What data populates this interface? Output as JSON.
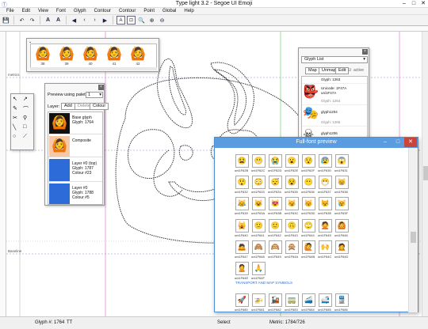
{
  "window": {
    "title": "Type light 3.2  -  Segoe UI Emoji"
  },
  "menu": [
    "File",
    "Edit",
    "View",
    "Font",
    "Glyph",
    "Contour",
    "Contour",
    "Point",
    "Global",
    "Help"
  ],
  "guides": {
    "metrics_label": "metrics",
    "baseline_label": "Baseline"
  },
  "palette_strip": {
    "labels": [
      "38",
      "39",
      "40",
      "41",
      "42"
    ]
  },
  "preview_panel": {
    "title": "Preview using palette:",
    "palette_value": "1",
    "layer_label": "Layer:",
    "add_label": "Add",
    "delete_label": "Delete",
    "colour_label": "Colour",
    "layers": [
      {
        "name": "Base glyph",
        "sub": "Glyph: 1764"
      },
      {
        "name": "Composite",
        "sub": ""
      },
      {
        "name": "Layer #0 (top)",
        "sub": "Glyph: 1787",
        "extra": "Colour #23"
      },
      {
        "name": "Layer #0",
        "sub": "Glyph: 1788",
        "extra": "Colour #5"
      }
    ]
  },
  "glyph_list": {
    "title": "Glyph List",
    "tabs": [
      "Map",
      "Unmap",
      "Edit"
    ],
    "active_label": "active",
    "items": [
      {
        "label": "Glyph: 1263"
      },
      {
        "label": "Unicode: 1F47A",
        "sub": "uni1F47A"
      },
      {
        "label": "Glyph: 1264"
      },
      {
        "label": "glyph1204"
      },
      {
        "label": "Glyph: 1265"
      },
      {
        "label": "glyph1206"
      },
      {
        "label": "Glyph: 1266"
      }
    ]
  },
  "full_font": {
    "title": "Full-font preview",
    "row_labels": [
      [
        "uni1F62B",
        "uni1F62C",
        "uni1F62D",
        "uni1F62E",
        "uni1F62F",
        "uni1F630",
        "uni1F631"
      ],
      [
        "uni1F632",
        "uni1F633",
        "uni1F634",
        "uni1F635",
        "uni1F636",
        "uni1F637",
        "uni1F638"
      ],
      [
        "uni1F639",
        "uni1F63A",
        "uni1F63B",
        "uni1F63C",
        "uni1F63D",
        "uni1F63E",
        "uni1F63F"
      ],
      [
        "uni1F640",
        "uni1F641",
        "uni1F642",
        "uni1F643",
        "uni1F644",
        "uni1F645",
        "uni1F646"
      ],
      [
        "uni1F647",
        "uni1F648",
        "uni1F649",
        "uni1F64A",
        "uni1F64B",
        "uni1F64C",
        "uni1F64D"
      ],
      [
        "uni1F64E",
        "uni1F64F"
      ],
      [
        "uni1F680",
        "uni1F681",
        "uni1F682",
        "uni1F683",
        "uni1F684",
        "uni1F685",
        "uni1F686"
      ]
    ],
    "rows_glyphs": [
      [
        "😫",
        "😬",
        "😭",
        "😮",
        "😯",
        "😰",
        "😱"
      ],
      [
        "😲",
        "😳",
        "😴",
        "😵",
        "😶",
        "😷",
        "😸"
      ],
      [
        "😹",
        "😺",
        "😻",
        "😼",
        "😽",
        "😾",
        "😿"
      ],
      [
        "🙀",
        "🙁",
        "🙂",
        "🙃",
        "🙄",
        "🙅",
        "🙆"
      ],
      [
        "🙇",
        "🙈",
        "🙉",
        "🙊",
        "🙋",
        "🙌",
        "🙍"
      ],
      [
        "🙎",
        "🙏"
      ],
      [
        "🚀",
        "🚁",
        "🚂",
        "🚃",
        "🚄",
        "🚅",
        "🚆"
      ]
    ],
    "section_title": "TRANSPORT AND MAP SYMBOLS"
  },
  "status": {
    "glyph": "Glyph #: 1764",
    "tt": "TT",
    "mode": "Select",
    "metrics": "Metric: 1784/726"
  }
}
